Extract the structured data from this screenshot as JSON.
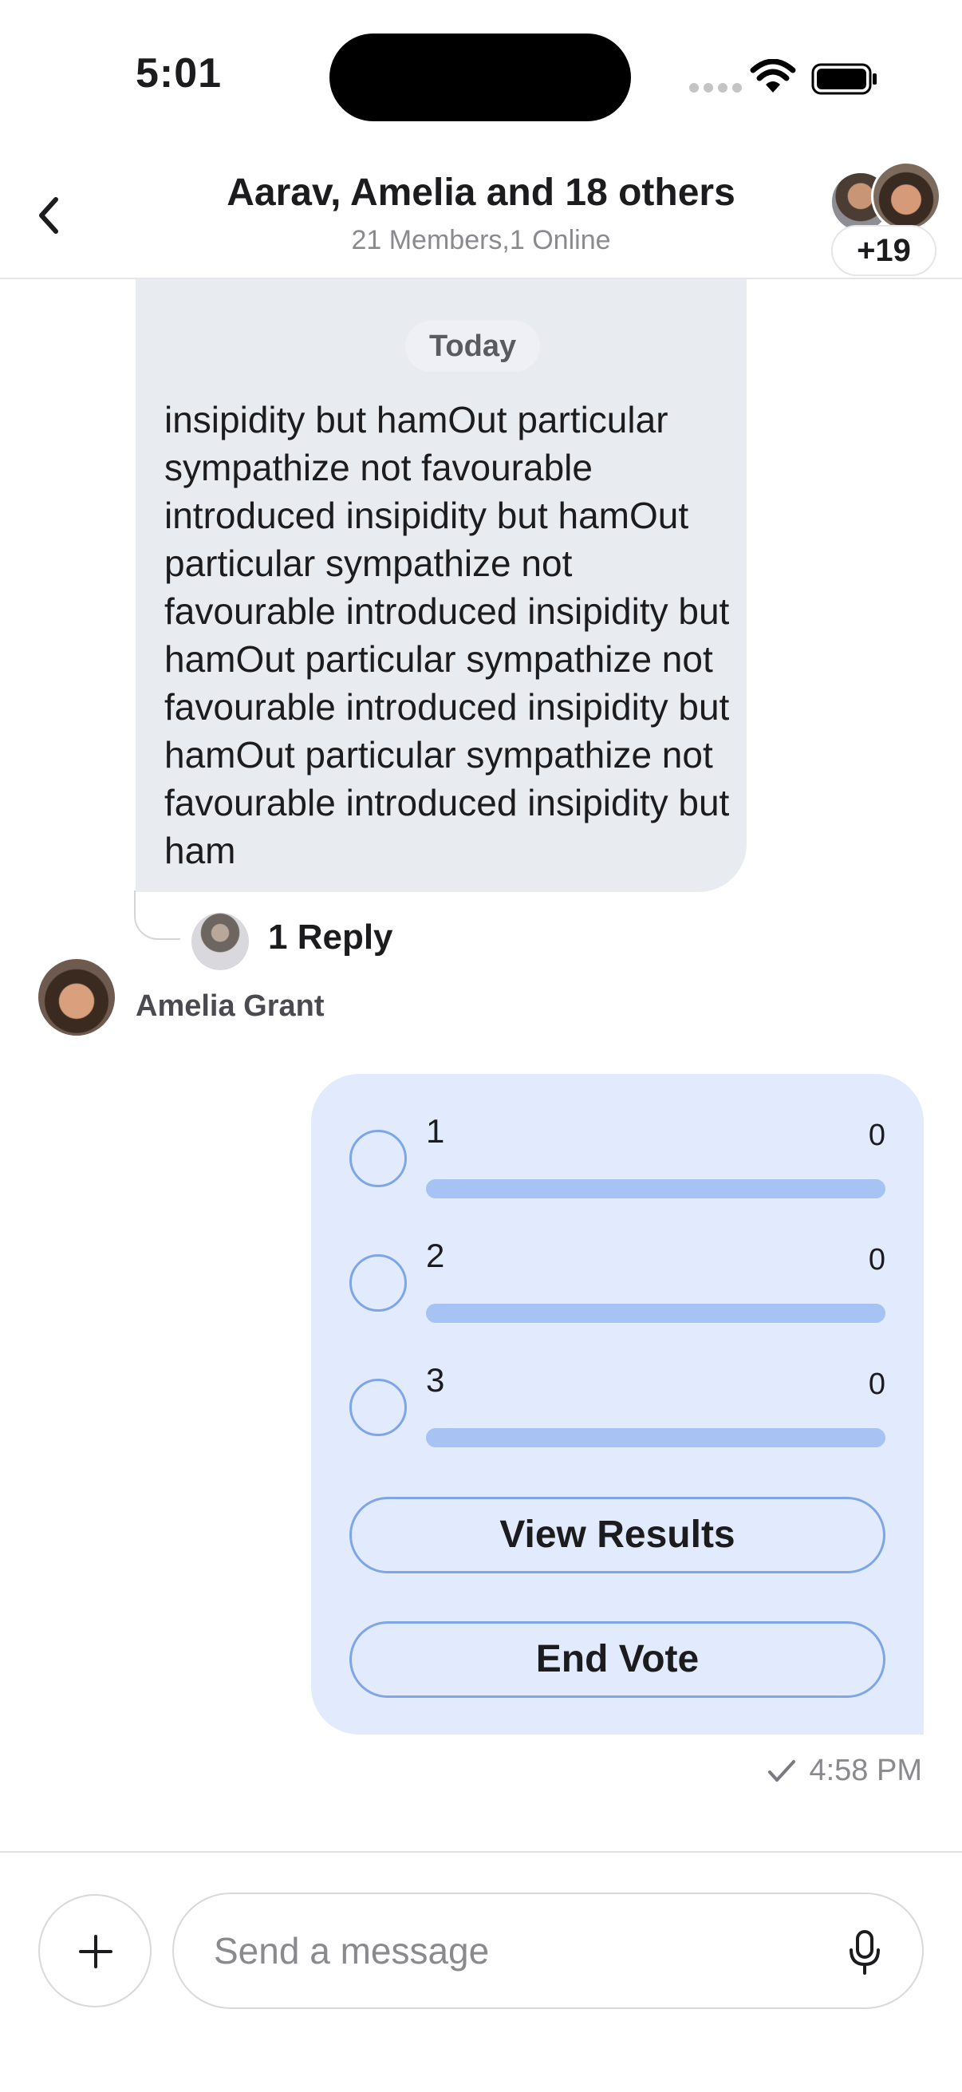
{
  "status_bar": {
    "time": "5:01"
  },
  "header": {
    "title": "Aarav, Amelia and 18 others",
    "subtitle": "21 Members,1 Online",
    "extra_count": "+19"
  },
  "thread": {
    "message_text": "insipidity but hamOut particular sympathize not favourable introduced insipidity but hamOut particular sympathize not favourable introduced insipidity but hamOut particular sympathize not favourable introduced insipidity but hamOut particular sympathize not favourable introduced insipidity but ham",
    "date_separator": "Today",
    "reply_count_label": "1 Reply",
    "sender_name": "Amelia Grant"
  },
  "poll": {
    "options": [
      {
        "label": "1",
        "votes": "0",
        "fraction": 0
      },
      {
        "label": "2",
        "votes": "0",
        "fraction": 0
      },
      {
        "label": "3",
        "votes": "0",
        "fraction": 0
      }
    ],
    "view_results_label": "View Results",
    "end_vote_label": "End Vote"
  },
  "message_status": {
    "time": "4:58 PM",
    "icon": "check-icon"
  },
  "composer": {
    "placeholder": "Send a message",
    "add_icon": "plus-icon",
    "mic_icon": "microphone-icon"
  },
  "colors": {
    "poll_background": "#e1ebfd",
    "poll_accent": "#7ea5e6",
    "received_bubble": "#e8ebf0"
  }
}
